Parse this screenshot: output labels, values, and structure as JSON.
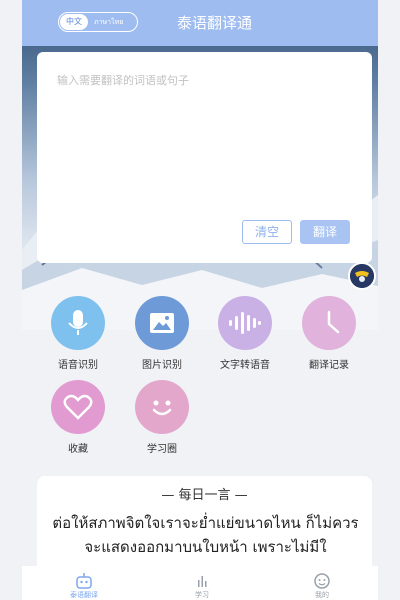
{
  "header": {
    "title": "泰语翻译通",
    "lang_active": "中文",
    "lang_other": "ภาษาไทย"
  },
  "input": {
    "placeholder": "输入需要翻译的词语或句子",
    "clear_label": "清空",
    "translate_label": "翻译"
  },
  "features": [
    {
      "label": "语音识别",
      "icon": "microphone-icon",
      "color": "#7fc1ee"
    },
    {
      "label": "图片识别",
      "icon": "image-icon",
      "color": "#6f9ad8"
    },
    {
      "label": "文字转语音",
      "icon": "audio-wave-icon",
      "color": "#c9b1e6"
    },
    {
      "label": "翻译记录",
      "icon": "clock-icon",
      "color": "#e0b2dc"
    },
    {
      "label": "收藏",
      "icon": "heart-icon",
      "color": "#e19bd1"
    },
    {
      "label": "学习圈",
      "icon": "smiley-icon",
      "color": "#e3a7cc"
    }
  ],
  "daily": {
    "title": "— 每日一言 —",
    "text": "ต่อให้สภาพจิตใจเราจะย่ำแย่ขนาดไหน ก็ไม่ควรจะแสดงออกมาบนใบหน้า เพราะไม่มีใ"
  },
  "tabbar": {
    "items": [
      {
        "label": "泰语翻译",
        "icon": "robot-icon",
        "active": true
      },
      {
        "label": "学习",
        "icon": "stats-icon",
        "active": false
      },
      {
        "label": "我的",
        "icon": "face-icon",
        "active": false
      }
    ]
  },
  "colors": {
    "accent": "#9ebcf0",
    "active_tab": "#7ea6ee"
  }
}
